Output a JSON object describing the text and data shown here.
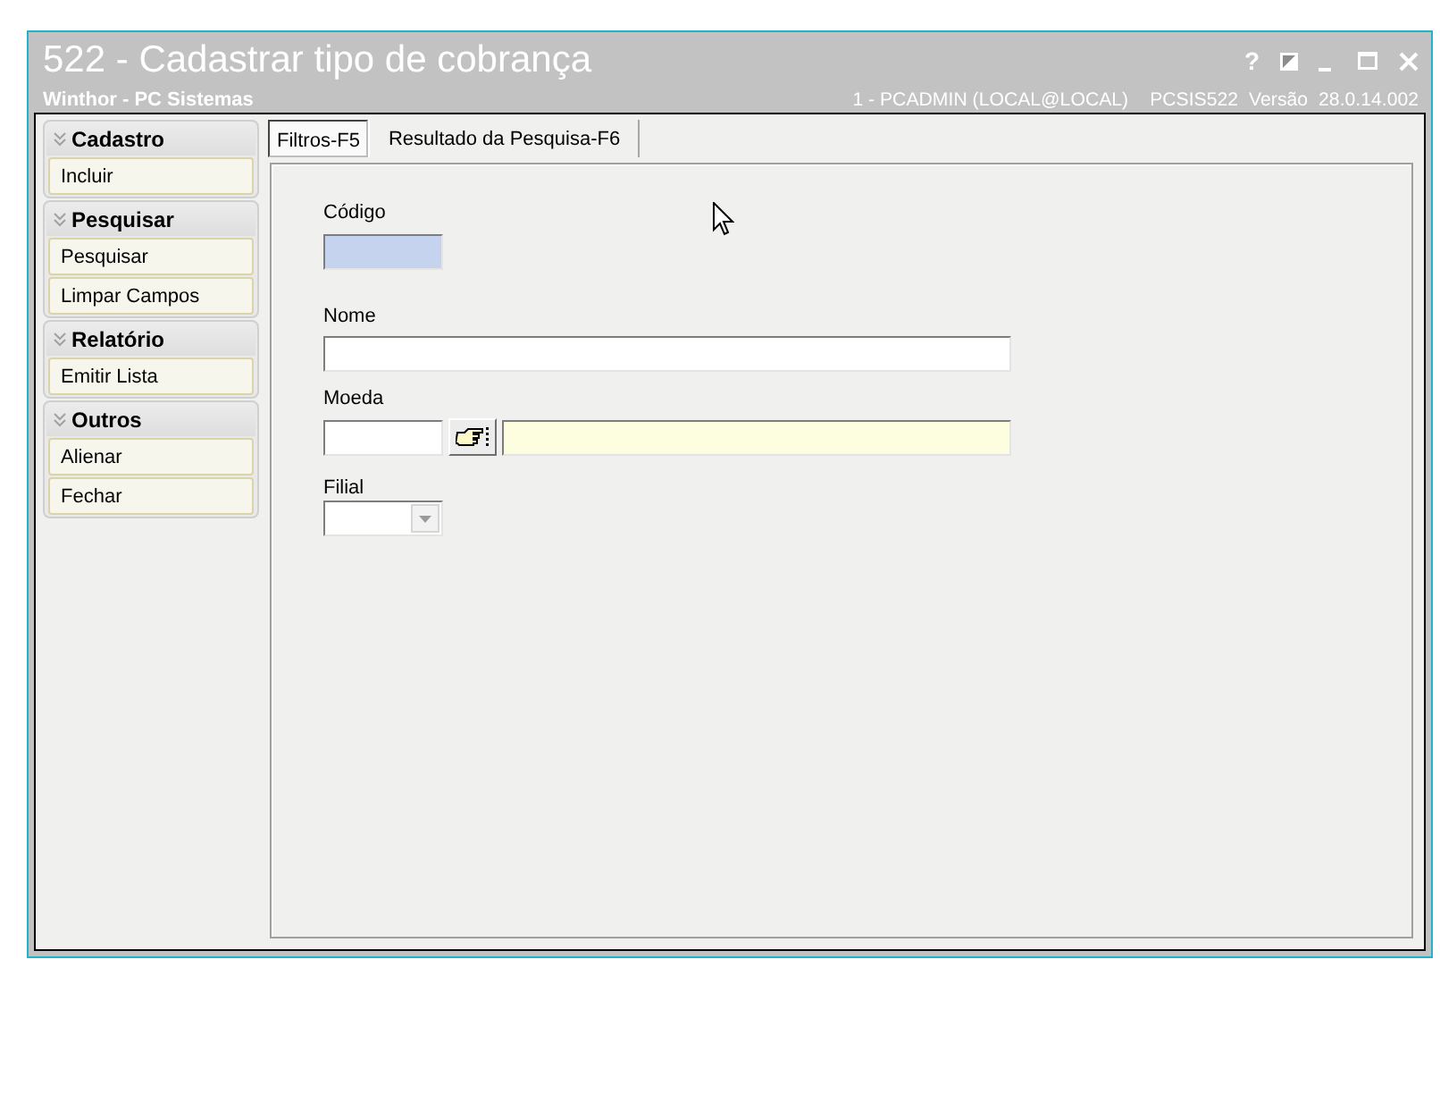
{
  "window": {
    "title": "522 - Cadastrar tipo de cobrança",
    "subtitle": "Winthor - PC Sistemas",
    "help": "?",
    "session": "1 - PCADMIN (LOCAL@LOCAL)",
    "program": "PCSIS522",
    "version_label": "Versão",
    "version": "28.0.14.002"
  },
  "sidebar": {
    "groups": [
      {
        "title": "Cadastro",
        "items": [
          "Incluir"
        ]
      },
      {
        "title": "Pesquisar",
        "items": [
          "Pesquisar",
          "Limpar Campos"
        ]
      },
      {
        "title": "Relatório",
        "items": [
          "Emitir Lista"
        ]
      },
      {
        "title": "Outros",
        "items": [
          "Alienar",
          "Fechar"
        ]
      }
    ]
  },
  "tabs": [
    {
      "label": "Filtros-F5",
      "selected": true
    },
    {
      "label": "Resultado da Pesquisa-F6",
      "selected": false
    }
  ],
  "form": {
    "fields": [
      {
        "kind": "code",
        "label": "Código",
        "focused": true
      },
      {
        "kind": "text",
        "label": "Nome",
        "focused": false
      },
      {
        "kind": "lookup",
        "label": "Moeda",
        "focused": false
      },
      {
        "kind": "select",
        "label": "Filial",
        "focused": false
      }
    ]
  }
}
